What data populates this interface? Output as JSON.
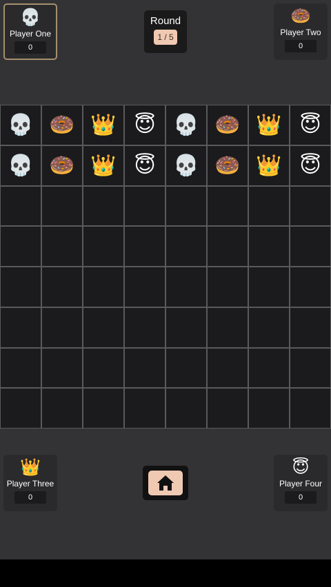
{
  "players": [
    {
      "name": "Player One",
      "emoji": "💀",
      "score": "0"
    },
    {
      "name": "Player Two",
      "emoji": "🍩",
      "score": "0"
    },
    {
      "name": "Player Three",
      "emoji": "👑",
      "score": "0"
    },
    {
      "name": "Player Four",
      "emoji": "😇",
      "score": "0"
    }
  ],
  "round": {
    "label": "Round",
    "counter": "1 / 5"
  },
  "board": {
    "rows": [
      [
        "💀",
        "🍩",
        "👑",
        "😇",
        "💀",
        "🍩",
        "👑",
        "😇"
      ],
      [
        "💀",
        "🍩",
        "👑",
        "😇",
        "💀",
        "🍩",
        "👑",
        "😇"
      ],
      [
        "",
        "",
        "",
        "",
        "",
        "",
        "",
        ""
      ],
      [
        "",
        "",
        "",
        "",
        "",
        "",
        "",
        ""
      ],
      [
        "",
        "",
        "",
        "",
        "",
        "",
        "",
        ""
      ],
      [
        "",
        "",
        "",
        "",
        "",
        "",
        "",
        ""
      ],
      [
        "",
        "",
        "",
        "",
        "",
        "",
        "",
        ""
      ],
      [
        "",
        "",
        "",
        "",
        "",
        "",
        "",
        ""
      ]
    ]
  },
  "home_icon": "home-icon"
}
